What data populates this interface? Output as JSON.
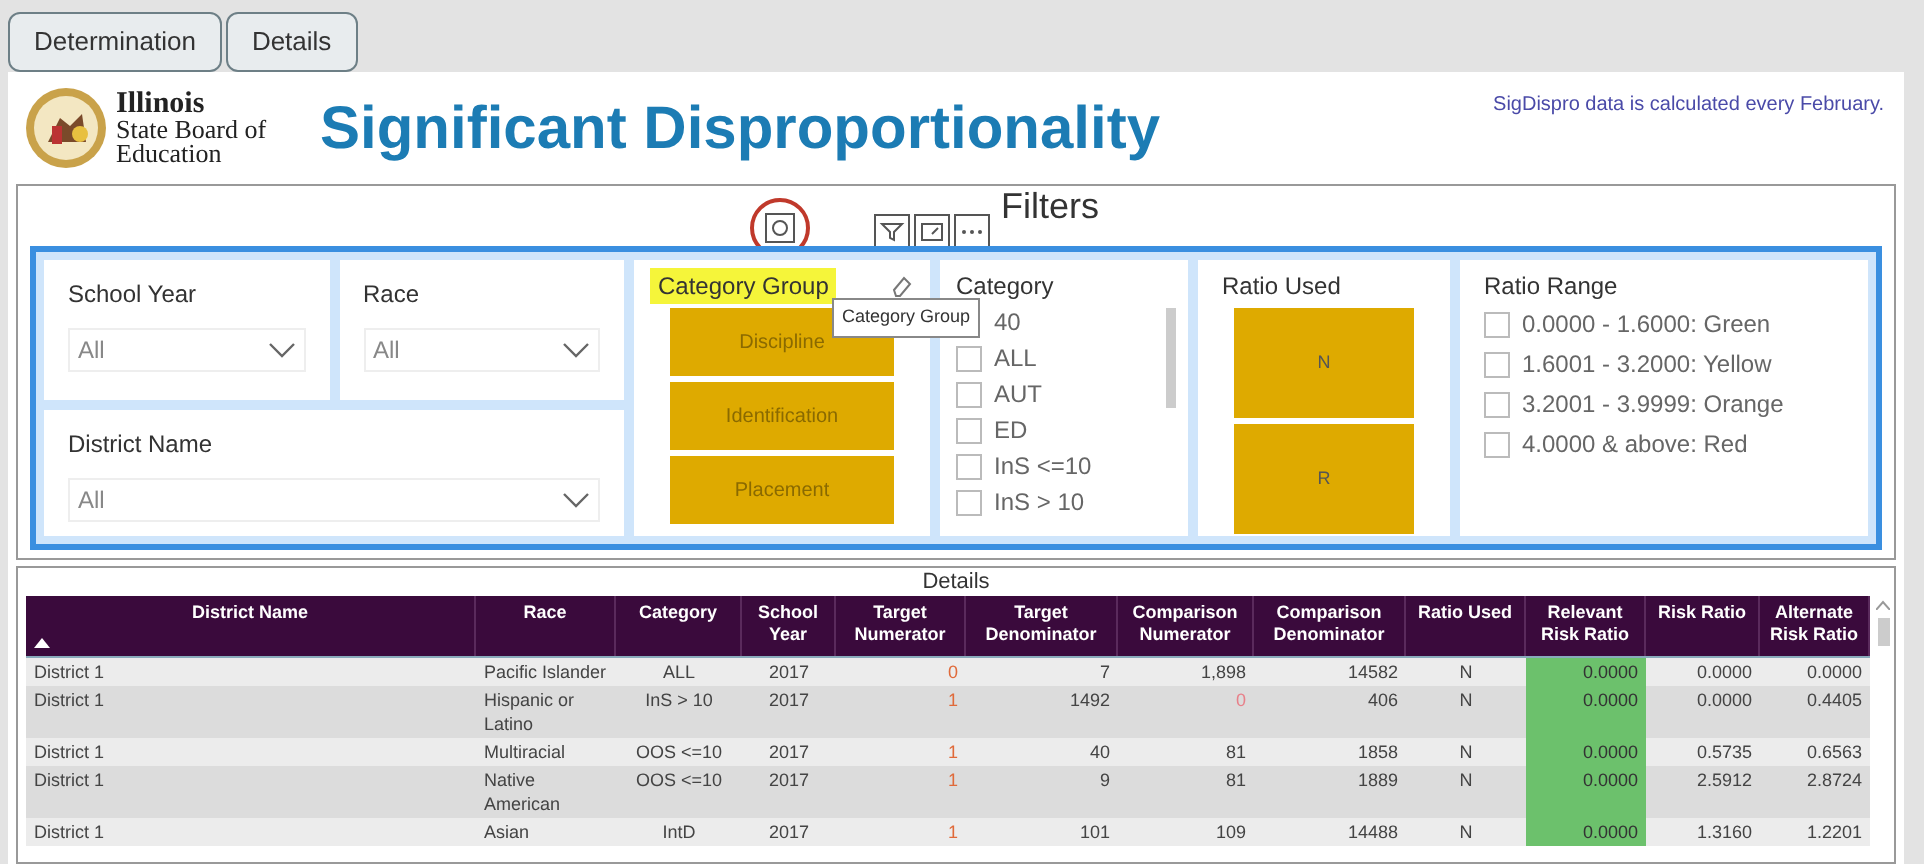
{
  "tabs": [
    {
      "label": "Determination",
      "selected": false
    },
    {
      "label": "Details",
      "selected": false
    }
  ],
  "header": {
    "org_lines": [
      "Illinois",
      "State Board of",
      "Education"
    ],
    "title": "Significant Disproportionality",
    "note": "SigDispro data is calculated every February."
  },
  "filters": {
    "title": "Filters",
    "tooltip": "Category Group",
    "dropdowns": [
      {
        "label": "School Year",
        "value": "All"
      },
      {
        "label": "Race",
        "value": "All"
      },
      {
        "label": "District Name",
        "value": "All"
      }
    ],
    "category_group": {
      "label": "Category Group",
      "highlighted": true,
      "options": [
        "Discipline",
        "Identification",
        "Placement"
      ]
    },
    "category": {
      "label": "Category",
      "items": [
        {
          "label": "40"
        },
        {
          "label": "ALL",
          "checked": false
        },
        {
          "label": "AUT",
          "checked": false
        },
        {
          "label": "ED",
          "checked": false
        },
        {
          "label": "InS <=10",
          "checked": false
        },
        {
          "label": "InS > 10",
          "checked": false
        }
      ]
    },
    "ratio_used": {
      "label": "Ratio Used",
      "options": [
        "N",
        "R"
      ]
    },
    "ratio_range": {
      "label": "Ratio Range",
      "items": [
        {
          "label": "0.0000 - 1.6000: Green",
          "checked": false
        },
        {
          "label": "1.6001 - 3.2000: Yellow",
          "checked": false
        },
        {
          "label": "3.2001 - 3.9999: Orange",
          "checked": false
        },
        {
          "label": "4.0000 & above: Red",
          "checked": false
        }
      ]
    }
  },
  "table": {
    "title": "Details",
    "columns": [
      {
        "label": "District Name",
        "kind": "plain",
        "sorted": true
      },
      {
        "label": "Race",
        "kind": "plain",
        "sorted": false
      },
      {
        "label": "Category",
        "kind": "plain",
        "sorted": false
      },
      {
        "label": "School Year",
        "kind": "plain",
        "sorted": false
      },
      {
        "label": "Target Numerator",
        "kind": "flag",
        "sorted": false
      },
      {
        "label": "Target Denominator",
        "kind": "plain",
        "sorted": false
      },
      {
        "label": "Comparison Numerator",
        "kind": "plain",
        "sorted": false
      },
      {
        "label": "Comparison Denominator",
        "kind": "plain",
        "sorted": false
      },
      {
        "label": "Ratio Used",
        "kind": "plain",
        "sorted": false
      },
      {
        "label": "Relevant Risk Ratio",
        "kind": "highlight",
        "sorted": false
      },
      {
        "label": "Risk Ratio",
        "kind": "plain",
        "sorted": false
      },
      {
        "label": "Alternate Risk Ratio",
        "kind": "plain",
        "sorted": false
      }
    ],
    "rows": [
      {
        "cells": [
          "District 1",
          "Pacific Islander",
          "ALL",
          "2017",
          "0",
          "7",
          "1,898",
          "14582",
          "N",
          "0.0000",
          "0.0000",
          "0.0000"
        ],
        "comparison_numerator_flagged": false
      },
      {
        "cells": [
          "District 1",
          "Hispanic or Latino",
          "InS > 10",
          "2017",
          "1",
          "1492",
          "0",
          "406",
          "N",
          "0.0000",
          "0.0000",
          "0.4405"
        ],
        "comparison_numerator_flagged": true
      },
      {
        "cells": [
          "District 1",
          "Multiracial",
          "OOS <=10",
          "2017",
          "1",
          "40",
          "81",
          "1858",
          "N",
          "0.0000",
          "0.5735",
          "0.6563"
        ],
        "comparison_numerator_flagged": false
      },
      {
        "cells": [
          "District 1",
          "Native American",
          "OOS <=10",
          "2017",
          "1",
          "9",
          "81",
          "1889",
          "N",
          "0.0000",
          "2.5912",
          "2.8724"
        ],
        "comparison_numerator_flagged": false
      },
      {
        "cells": [
          "District 1",
          "Asian",
          "IntD",
          "2017",
          "1",
          "101",
          "109",
          "14488",
          "N",
          "0.0000",
          "1.3160",
          "1.2201"
        ],
        "comparison_numerator_flagged": false
      }
    ]
  }
}
